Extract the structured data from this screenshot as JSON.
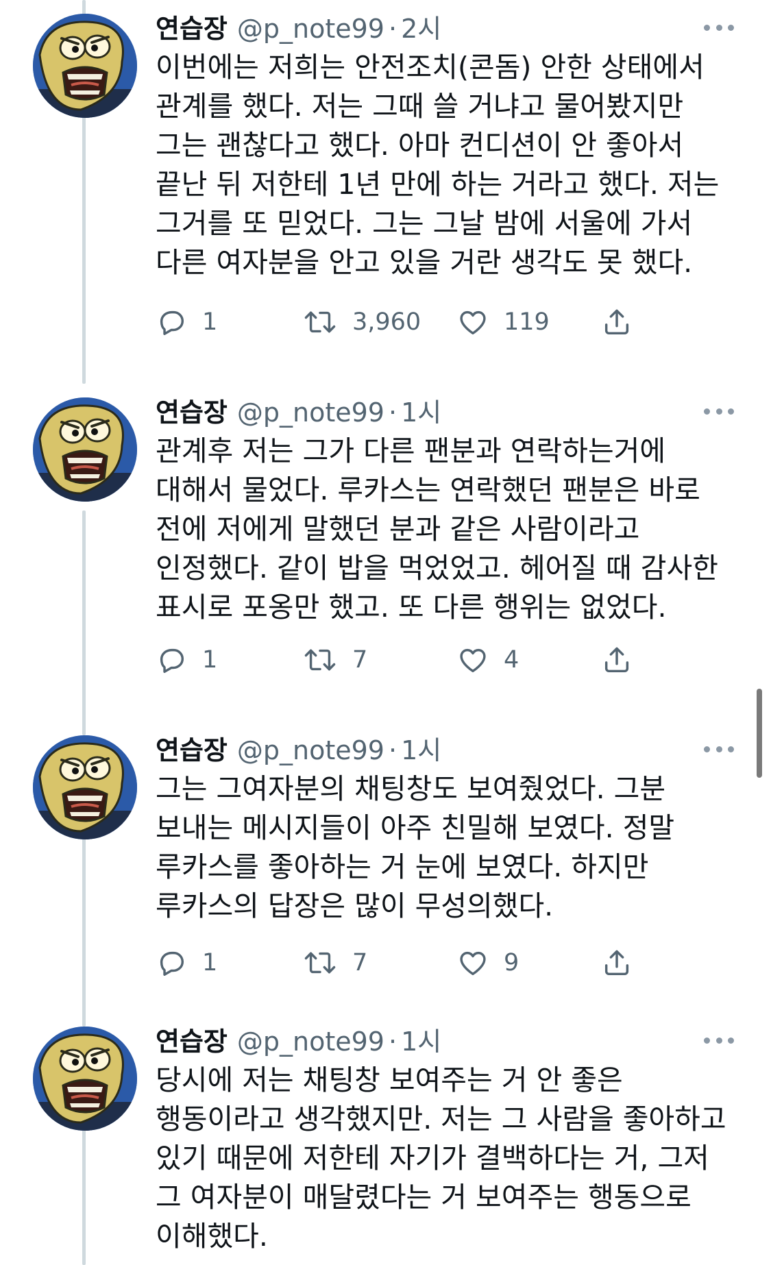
{
  "author": {
    "name": "연습장",
    "handle": "@p_note99",
    "separator": "·"
  },
  "tweets": [
    {
      "time": "2시",
      "text": "이번에는 저희는 안전조치(콘돔) 안한 상태에서 관계를 했다. 저는 그때 쓸 거냐고 물어봤지만 그는 괜찮다고 했다. 아마 컨디션이 안 좋아서 끝난 뒤 저한테 1년 만에 하는 거라고 했다. 저는 그거를 또 믿었다. 그는 그날 밤에 서울에 가서 다른 여자분을 안고 있을 거란 생각도 못 했다.",
      "replies": "1",
      "retweets": "3,960",
      "likes": "119"
    },
    {
      "time": "1시",
      "text": "관계후 저는 그가 다른 팬분과 연락하는거에 대해서 물었다. 루카스는 연락했던 팬분은 바로 전에 저에게 말했던 분과 같은 사람이라고 인정했다. 같이 밥을 먹었었고. 헤어질 때 감사한 표시로 포옹만 했고. 또 다른 행위는 없었다.",
      "replies": "1",
      "retweets": "7",
      "likes": "4"
    },
    {
      "time": "1시",
      "text": "그는 그여자분의 채팅창도 보여줬었다. 그분 보내는 메시지들이 아주 친밀해 보였다. 정말 루카스를 좋아하는 거 눈에 보였다. 하지만 루카스의 답장은 많이 무성의했다.",
      "replies": "1",
      "retweets": "7",
      "likes": "9"
    },
    {
      "time": "1시",
      "text": "당시에 저는 채팅창 보여주는 거 안 좋은 행동이라고 생각했지만. 저는 그 사람을 좋아하고 있기 때문에 저한테 자기가 결백하다는 거, 그저 그 여자분이 매달렸다는 거 보여주는 행동으로 이해했다."
    }
  ],
  "icons": {
    "reply": "reply-icon",
    "retweet": "retweet-icon",
    "like": "heart-icon",
    "share": "share-icon",
    "more": "more-icon"
  },
  "colors": {
    "text": "#0f1419",
    "muted": "#536471",
    "thread_line": "#cfd9de",
    "avatar_background": "#2b5aa8"
  }
}
